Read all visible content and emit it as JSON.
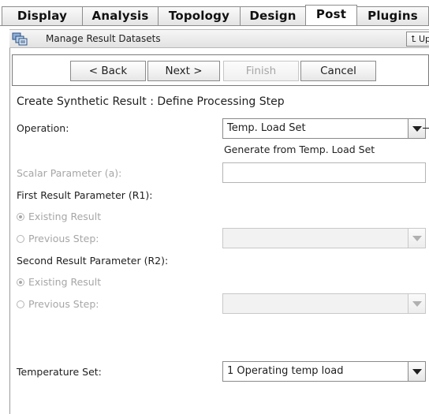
{
  "tabs": [
    {
      "label": "Display",
      "active": false
    },
    {
      "label": "Analysis",
      "active": false
    },
    {
      "label": "Topology",
      "active": false
    },
    {
      "label": "Design",
      "active": false
    },
    {
      "label": "Post",
      "active": true
    },
    {
      "label": "Plugins",
      "active": false
    }
  ],
  "titlebar": {
    "title": "Manage Result Datasets",
    "up_label": "⮤ Up",
    "icon": "datasets-icon"
  },
  "nav": {
    "back_label": "< Back",
    "next_label": "Next >",
    "finish_label": "Finish",
    "cancel_label": "Cancel"
  },
  "form": {
    "heading": "Create Synthetic Result : Define Processing Step",
    "operation_label": "Operation:",
    "operation_value": "Temp. Load Set",
    "operation_hint": "Generate from Temp. Load Set",
    "scalar_label": "Scalar Parameter (a):",
    "scalar_value": "",
    "r1_label": "First Result Parameter (R1):",
    "r1_existing": "Existing Result",
    "r1_previous": "Previous Step:",
    "r1_selected": "existing",
    "r2_label": "Second Result Parameter (R2):",
    "r2_existing": "Existing Result",
    "r2_previous": "Previous Step:",
    "r2_selected": "existing",
    "temp_label": "Temperature Set:",
    "temp_value": "1 Operating temp load"
  },
  "colors": {
    "disabled_text": "#a6a6a6",
    "border": "#8a8a8a"
  }
}
